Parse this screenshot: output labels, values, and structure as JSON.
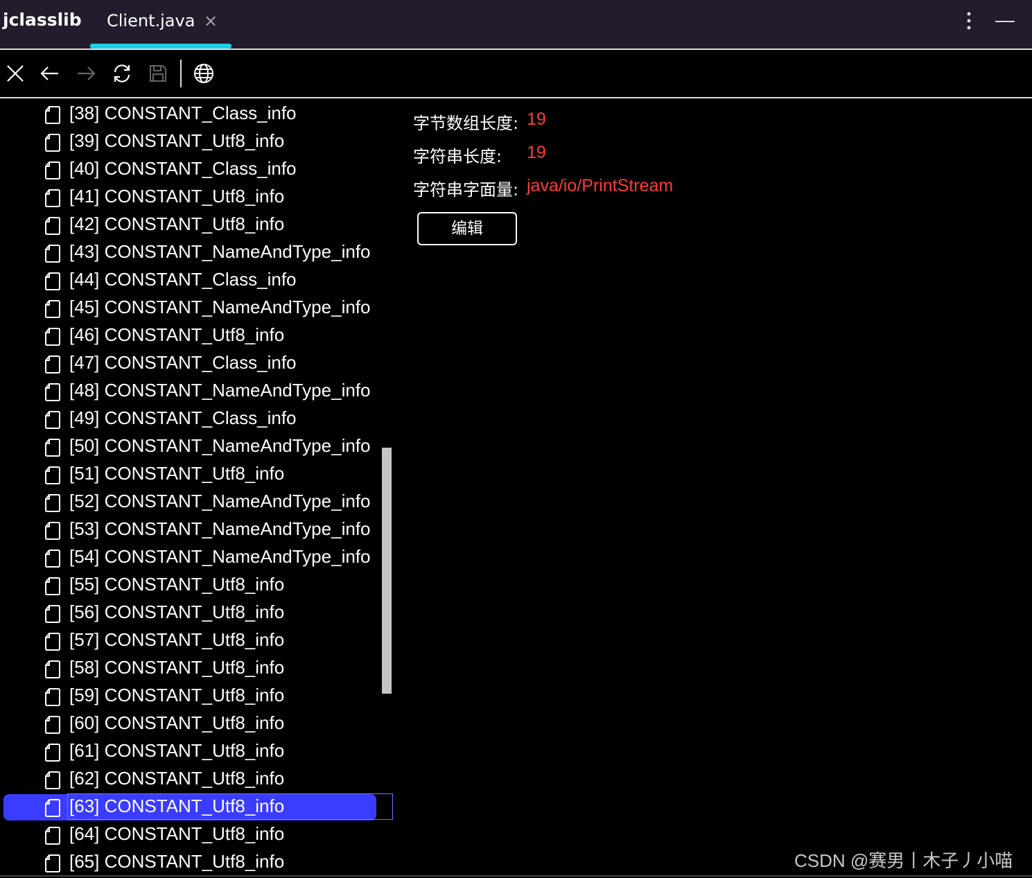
{
  "titlebar": {
    "app_name": "jclasslib",
    "tab_label": "Client.java",
    "tab_close": "×",
    "accent_color": "#19d2e6"
  },
  "toolbar": {
    "icons": [
      "close-icon",
      "back-arrow-icon",
      "forward-arrow-icon",
      "refresh-icon",
      "save-icon",
      "globe-icon"
    ]
  },
  "tree": {
    "items": [
      "[38] CONSTANT_Class_info",
      "[39] CONSTANT_Utf8_info",
      "[40] CONSTANT_Class_info",
      "[41] CONSTANT_Utf8_info",
      "[42] CONSTANT_Utf8_info",
      "[43] CONSTANT_NameAndType_info",
      "[44] CONSTANT_Class_info",
      "[45] CONSTANT_NameAndType_info",
      "[46] CONSTANT_Utf8_info",
      "[47] CONSTANT_Class_info",
      "[48] CONSTANT_NameAndType_info",
      "[49] CONSTANT_Class_info",
      "[50] CONSTANT_NameAndType_info",
      "[51] CONSTANT_Utf8_info",
      "[52] CONSTANT_NameAndType_info",
      "[53] CONSTANT_NameAndType_info",
      "[54] CONSTANT_NameAndType_info",
      "[55] CONSTANT_Utf8_info",
      "[56] CONSTANT_Utf8_info",
      "[57] CONSTANT_Utf8_info",
      "[58] CONSTANT_Utf8_info",
      "[59] CONSTANT_Utf8_info",
      "[60] CONSTANT_Utf8_info",
      "[61] CONSTANT_Utf8_info",
      "[62] CONSTANT_Utf8_info",
      "[63] CONSTANT_Utf8_info",
      "[64] CONSTANT_Utf8_info",
      "[65] CONSTANT_Utf8_info"
    ],
    "selected": "[63] CONSTANT_Utf8_info",
    "selection_color": "#3a3cff"
  },
  "details": {
    "byte_length_label": "字节数组长度:",
    "byte_length_value": "19",
    "string_length_label": "字符串长度:",
    "string_length_value": "19",
    "string_literal_label": "字符串字面量:",
    "string_literal_value": "java/io/PrintStream",
    "value_color": "#ff3b3b",
    "edit_button": "编辑"
  },
  "watermark": "CSDN @赛男丨木子丿小喵"
}
